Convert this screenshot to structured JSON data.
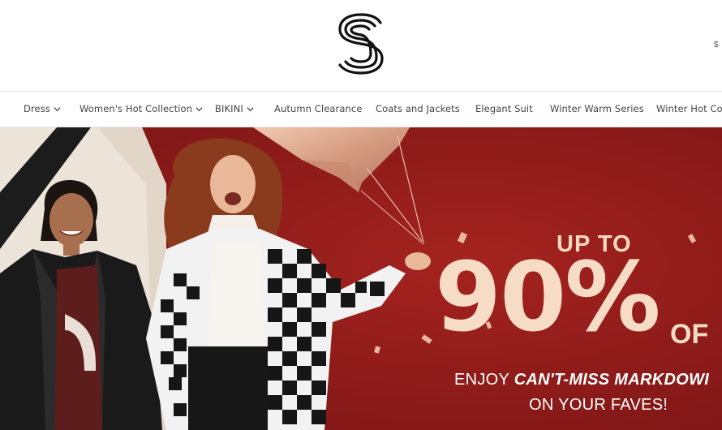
{
  "header": {
    "logo_icon": "s-monogram-logo",
    "currency_label": "$"
  },
  "nav": {
    "items": [
      {
        "label": "Dress",
        "has_dropdown": true
      },
      {
        "label": "Women's Hot Collection",
        "has_dropdown": true
      },
      {
        "label": "BIKINI",
        "has_dropdown": true
      },
      {
        "label": "Autumn Clearance",
        "has_dropdown": false
      },
      {
        "label": "Coats and Jackets",
        "has_dropdown": false
      },
      {
        "label": "Elegant Suit",
        "has_dropdown": false
      },
      {
        "label": "Winter Warm Series",
        "has_dropdown": false
      },
      {
        "label": "Winter Hot Colle",
        "has_dropdown": false
      }
    ]
  },
  "banner": {
    "upto": "UP TO",
    "percent": "90%",
    "off": "OF",
    "line1_prefix": "ENJOY ",
    "line1_emphasis": "CAN'T-MISS MARKDOWI",
    "line2": "ON YOUR FAVES!",
    "colors": {
      "background": "#8c1a1a",
      "promo_text": "#f6dcc4",
      "balloon": "#d9a58a"
    }
  }
}
